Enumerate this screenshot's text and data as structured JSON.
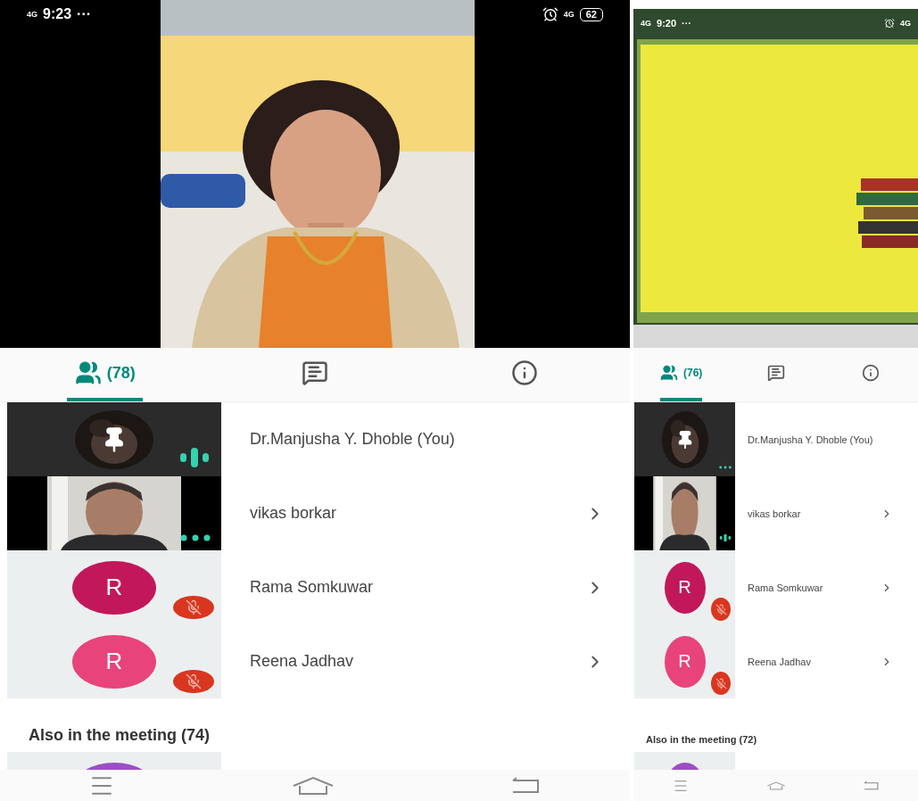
{
  "phones": [
    {
      "status_bar": {
        "network": "4G",
        "time": "9:23",
        "more": "···",
        "network_right": "4G",
        "battery": "62"
      },
      "video": {
        "kind": "picture"
      },
      "tabs": [
        {
          "kind": "people",
          "label": "(78)",
          "selected": true
        },
        {
          "kind": "chat",
          "selected": false
        },
        {
          "kind": "info",
          "selected": false
        }
      ],
      "participants": [
        {
          "name": "Dr.Manjusha Y. Dhoble (You)",
          "kind": "pinned",
          "speaking": true,
          "muted": false,
          "expandable": false
        },
        {
          "name": "vikas borkar",
          "kind": "video",
          "speaking": false,
          "muted": false,
          "expandable": true
        },
        {
          "name": "Rama Somkuwar",
          "kind": "avatar",
          "initial": "R",
          "color": "#c2185b",
          "muted": true,
          "expandable": true
        },
        {
          "name": "Reena Jadhav",
          "kind": "avatar",
          "initial": "R",
          "color": "#e8437a",
          "muted": true,
          "expandable": true
        }
      ],
      "section_title": "Also in the meeting (74)",
      "more_participants": [
        {
          "color": "#9b4fc4"
        }
      ]
    },
    {
      "status_bar": {
        "network": "4G",
        "time": "9:20",
        "more": "···",
        "network_right": "4G"
      },
      "video": {
        "kind": "picture"
      },
      "tabs": [
        {
          "kind": "people",
          "label": "(76)",
          "selected": true
        },
        {
          "kind": "chat",
          "selected": false
        },
        {
          "kind": "info",
          "selected": false
        }
      ],
      "participants": [
        {
          "name": "Dr.Manjusha Y. Dhoble (You)",
          "kind": "pinned",
          "speaking": false,
          "muted": false,
          "expandable": false
        },
        {
          "name": "vikas borkar",
          "kind": "video",
          "speaking": true,
          "muted": false,
          "expandable": true
        },
        {
          "name": "Rama Somkuwar",
          "kind": "avatar",
          "initial": "R",
          "color": "#c2185b",
          "muted": true,
          "expandable": true
        },
        {
          "name": "Reena Jadhav",
          "kind": "avatar",
          "initial": "R",
          "color": "#e8437a",
          "muted": true,
          "expandable": true
        }
      ],
      "section_title": "Also in the meeting (72)",
      "more_participants": [
        {
          "color": "#9b4fc4"
        }
      ]
    }
  ]
}
